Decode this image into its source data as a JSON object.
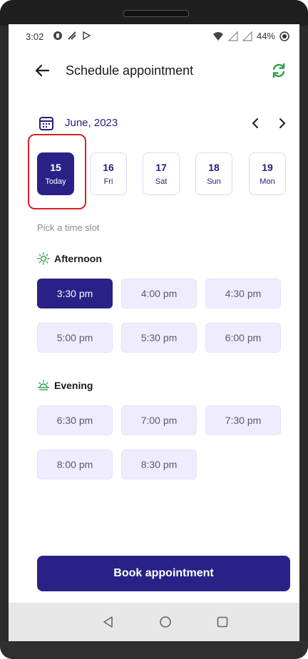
{
  "status_bar": {
    "time": "3:02",
    "battery": "44%"
  },
  "header": {
    "title": "Schedule appointment",
    "accent_color": "#2ba34a"
  },
  "calendar": {
    "month_label": "June, 2023",
    "days": [
      {
        "num": "15",
        "label": "Today",
        "selected": true
      },
      {
        "num": "16",
        "label": "Fri",
        "selected": false
      },
      {
        "num": "17",
        "label": "Sat",
        "selected": false
      },
      {
        "num": "18",
        "label": "Sun",
        "selected": false
      },
      {
        "num": "19",
        "label": "Mon",
        "selected": false
      }
    ]
  },
  "pick_label": "Pick a time slot",
  "afternoon": {
    "label": "Afternoon",
    "slots": [
      "3:30 pm",
      "4:00 pm",
      "4:30 pm",
      "5:00 pm",
      "5:30 pm",
      "6:00 pm"
    ],
    "selected": "3:30 pm"
  },
  "evening": {
    "label": "Evening",
    "slots": [
      "6:30 pm",
      "7:00 pm",
      "7:30 pm",
      "8:00 pm",
      "8:30 pm"
    ]
  },
  "book_button": "Book appointment",
  "colors": {
    "primary": "#2a2187",
    "slot_bg": "#efedfd",
    "highlight": "#d81f26"
  }
}
